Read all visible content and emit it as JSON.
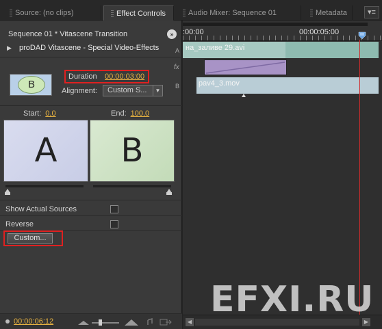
{
  "tabs": [
    {
      "label": "Source: (no clips)",
      "active": false
    },
    {
      "label": "Effect Controls",
      "active": true
    },
    {
      "label": "Audio Mixer: Sequence 01",
      "active": false
    },
    {
      "label": "Metadata",
      "active": false
    }
  ],
  "effect_controls": {
    "sequence_title": "Sequence 01 * Vitascene Transition",
    "effect_name": "proDAD Vitascene - Special Video-Effects",
    "fx_icon": "fx",
    "thumbnail_letter": "B",
    "duration_label": "Duration",
    "duration_value": "00:00:03:00",
    "alignment_label": "Alignment:",
    "alignment_value": "Custom S...",
    "start_label": "Start:",
    "start_value": "0,0",
    "end_label": "End:",
    "end_value": "100,0",
    "preview_a": "A",
    "preview_b": "B",
    "show_actual_sources_label": "Show Actual Sources",
    "show_actual_sources_checked": false,
    "reverse_label": "Reverse",
    "reverse_checked": false,
    "custom_button_label": "Custom...",
    "footer_timecode": "00:00:06:12"
  },
  "timeline": {
    "ruler_start": ":00:00",
    "ruler_mark": "00:00:05:00",
    "track_a_letter": "A",
    "track_b_letter": "B",
    "clip_a": "на_заливе 29.avi",
    "clip_b": "pav4_3.mov"
  },
  "watermark": "EFXI.RU",
  "colors": {
    "timecode": "#e8b341",
    "highlight_box": "#e02020",
    "clip_a": "#8ebbb0",
    "transition": "#a893c6",
    "clip_b": "#b9cdd6",
    "playhead": "#d02b2b"
  }
}
